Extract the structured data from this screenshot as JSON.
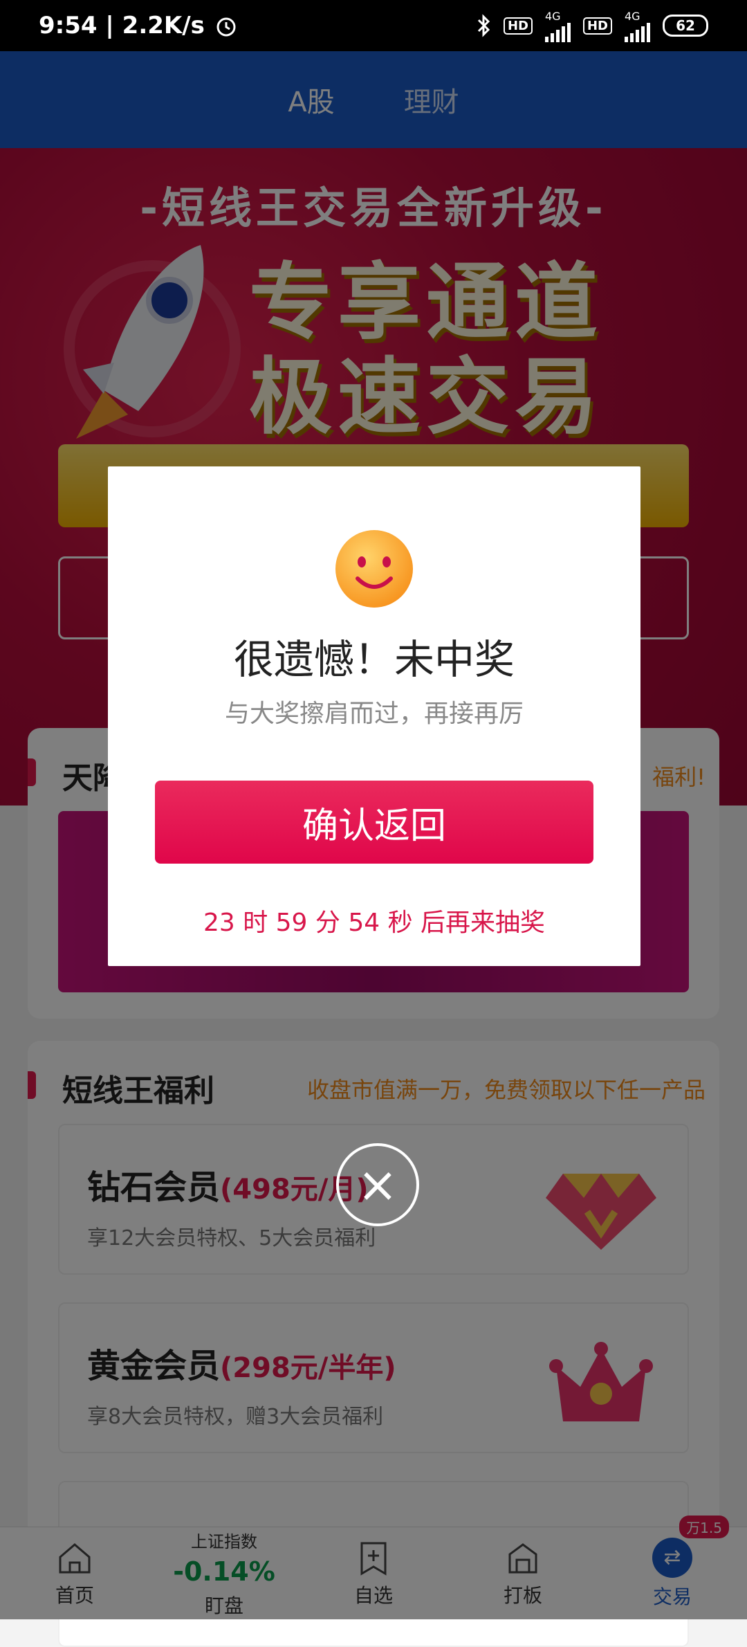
{
  "status_bar": {
    "time_speed": "9:54 | 2.2K/s",
    "battery": "62",
    "net1": "4G",
    "net2": "4G",
    "hd": "HD"
  },
  "tabs": [
    {
      "label": "A股"
    },
    {
      "label": "理财"
    }
  ],
  "hero": {
    "subtitle": "-短线王交易全新升级-",
    "title_line1": "专享通道",
    "title_line2": "极速交易"
  },
  "section_a": {
    "title": "天降",
    "note": "福利!"
  },
  "section_b": {
    "title": "短线王福利",
    "note": "收盘市值满一万，免费领取以下任一产品",
    "products": [
      {
        "name": "钻石会员",
        "price": "(498元/月)",
        "desc": "享12大会员特权、5大会员福利"
      },
      {
        "name": "黄金会员",
        "price": "(298元/半年)",
        "desc": "享8大会员特权，赠3大会员福利"
      }
    ]
  },
  "bottom_nav": {
    "home": "首页",
    "index_name": "上证指数",
    "index_value": "-0.14%",
    "watch": "盯盘",
    "favorites": "自选",
    "limit_up": "打板",
    "trade": "交易",
    "trade_badge": "万1.5"
  },
  "modal": {
    "title": "很遗憾！未中奖",
    "subtitle": "与大奖擦肩而过，再接再厉",
    "confirm_label": "确认返回",
    "countdown": "23 时 59 分 54 秒 后再来抽奖"
  },
  "colors": {
    "accent": "#e0184d",
    "blue": "#1a5bc6",
    "green": "#0a9c4c",
    "orange": "#f08a1b"
  }
}
